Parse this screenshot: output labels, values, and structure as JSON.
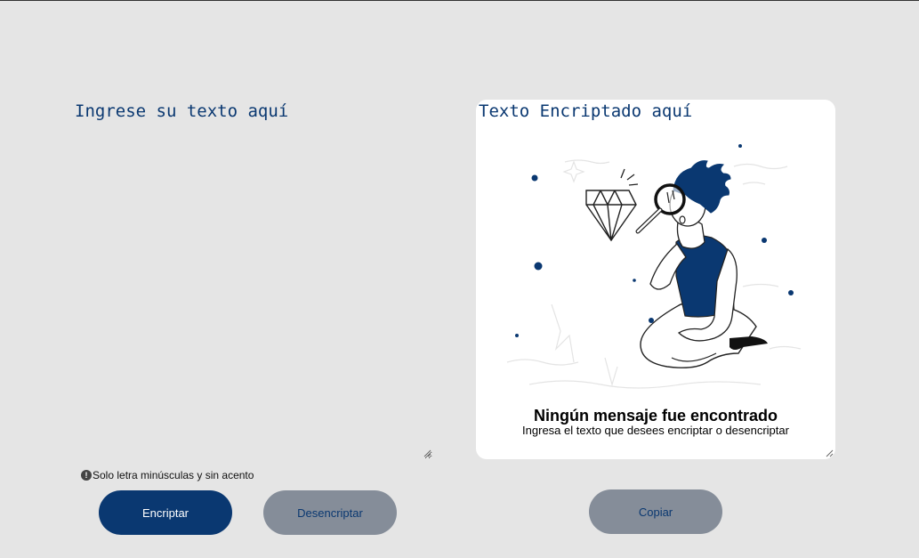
{
  "input": {
    "placeholder": "Ingrese su texto aquí",
    "value": ""
  },
  "hint": {
    "icon": "info-icon",
    "icon_glyph": "!",
    "text": "Solo letra minúsculas y sin acento"
  },
  "buttons": {
    "encrypt_label": "Encriptar",
    "decrypt_label": "Desencriptar",
    "copy_label": "Copiar"
  },
  "output": {
    "title": "Texto Encriptado aquí",
    "empty_title": "Ningún mensaje fue encontrado",
    "empty_subtitle": "Ingresa el texto que desees encriptar o desencriptar",
    "illustration": "person-with-magnifying-glass-and-diamond"
  },
  "colors": {
    "background": "#e5e5e5",
    "primary": "#0a3871",
    "secondary_button": "#858d99",
    "panel": "#ffffff"
  }
}
